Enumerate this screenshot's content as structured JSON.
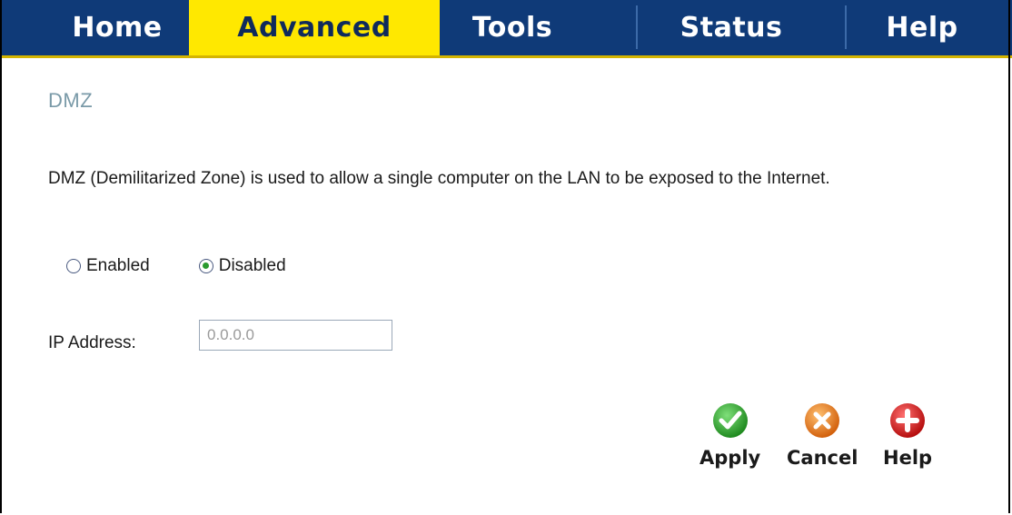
{
  "tabs": [
    {
      "label": "Home"
    },
    {
      "label": "Advanced"
    },
    {
      "label": "Tools"
    },
    {
      "label": "Status"
    },
    {
      "label": "Help"
    }
  ],
  "active_tab": "Advanced",
  "page": {
    "title": "DMZ",
    "description": "DMZ (Demilitarized Zone) is used to allow a single computer on the LAN to be exposed to the Internet."
  },
  "dmz_mode": {
    "enabled_label": "Enabled",
    "disabled_label": "Disabled",
    "selected": "Disabled"
  },
  "ip_address": {
    "label": "IP Address:",
    "value": "0.0.0.0"
  },
  "actions": {
    "apply_label": "Apply",
    "cancel_label": "Cancel",
    "help_label": "Help"
  },
  "colors": {
    "tab_bar": "#0f3a78",
    "active_tab": "#ffe800",
    "apply_icon": "#2aa12a",
    "cancel_icon": "#e87a1a",
    "help_icon": "#d81e1e"
  },
  "icons": {
    "apply": "check-icon",
    "cancel": "x-icon",
    "help": "plus-icon"
  }
}
